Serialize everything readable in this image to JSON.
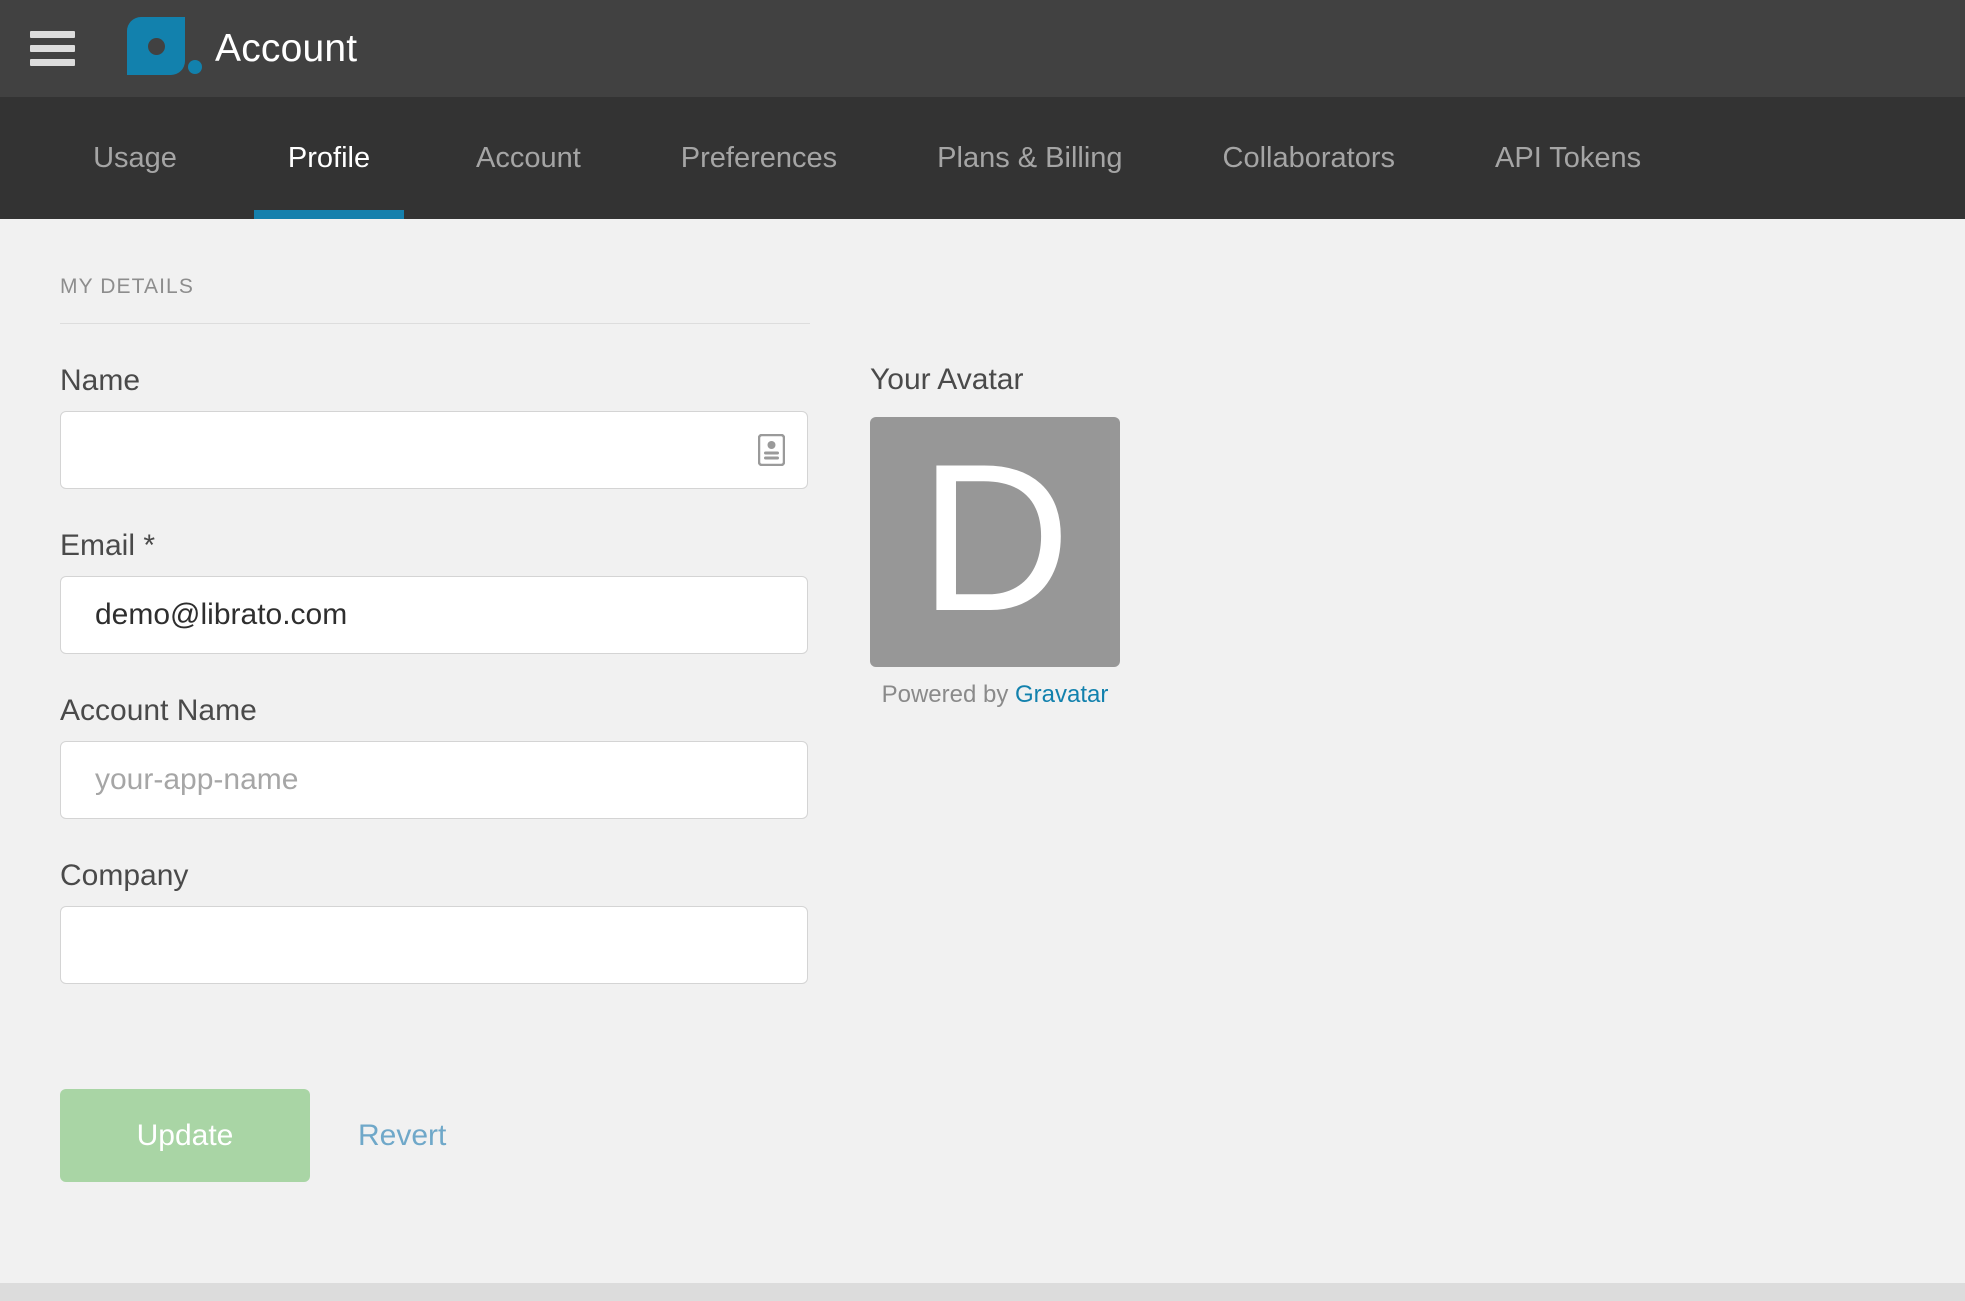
{
  "header": {
    "menu_icon": "hamburger-icon",
    "logo_icon": "librato-logo-icon",
    "title": "Account",
    "brand_color": "#1281ad",
    "background": "#414141"
  },
  "tabs": {
    "active_indicator_color": "#1580ad",
    "background": "#333333",
    "items": [
      {
        "label": "Usage",
        "active": false
      },
      {
        "label": "Profile",
        "active": true
      },
      {
        "label": "Account",
        "active": false
      },
      {
        "label": "Preferences",
        "active": false
      },
      {
        "label": "Plans & Billing",
        "active": false
      },
      {
        "label": "Collaborators",
        "active": false
      },
      {
        "label": "API Tokens",
        "active": false
      }
    ]
  },
  "main": {
    "section_title": "MY DETAILS",
    "fields": [
      {
        "label": "Name",
        "value": "",
        "placeholder": "",
        "required": false,
        "icon": "contact-card-icon"
      },
      {
        "label": "Email",
        "required_marker": "*",
        "value": "demo@librato.com",
        "placeholder": "",
        "required": true
      },
      {
        "label": "Account Name",
        "value": "",
        "placeholder": "your-app-name",
        "required": false
      },
      {
        "label": "Company",
        "value": "",
        "placeholder": "",
        "required": false
      }
    ],
    "actions": {
      "update_label": "Update",
      "update_color": "#a9d5a5",
      "revert_label": "Revert",
      "revert_color": "#6fa8c9"
    }
  },
  "avatar": {
    "title": "Your Avatar",
    "letter": "D",
    "background": "#979797",
    "caption_prefix": "Powered by",
    "caption_link": "Gravatar",
    "link_color": "#1281ad"
  }
}
